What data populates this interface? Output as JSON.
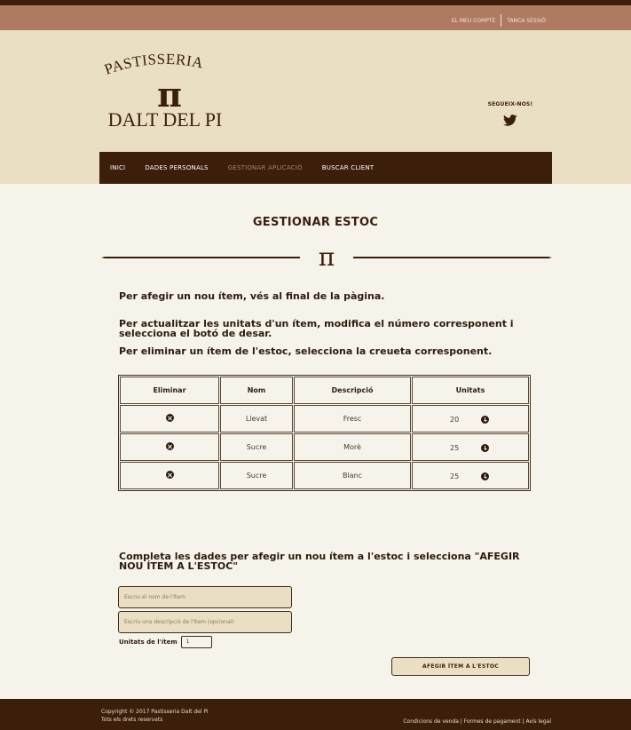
{
  "topbar": {
    "account": "EL MEU COMPTE",
    "logout": "TANCA SESSIÓ"
  },
  "logo": {
    "line1": "PASTISSERIA",
    "symbol": "π",
    "line2": "DALT DEL PI"
  },
  "social": {
    "label": "SEGUEIX-NOS!",
    "icon": "twitter-icon"
  },
  "nav": [
    {
      "label": "INICI",
      "active": false
    },
    {
      "label": "DADES PERSONALS",
      "active": false
    },
    {
      "label": "GESTIONAR APLICACIÓ",
      "active": true
    },
    {
      "label": "BUSCAR CLIENT",
      "active": false
    }
  ],
  "page": {
    "title": "GESTIONAR ESTOC",
    "divider_symbol": "π"
  },
  "instructions": {
    "line1": "Per afegir un nou ítem, vés al final de la pàgina.",
    "line2": "Per actualitzar les unitats d'un ítem, modifica el número corresponent i selecciona el botó de desar.",
    "line3": "Per eliminar un ítem de l'estoc, selecciona la creueta corresponent."
  },
  "table": {
    "headers": [
      "Eliminar",
      "Nom",
      "Descripció",
      "Unitats"
    ],
    "rows": [
      {
        "name": "Llevat",
        "description": "Fresc",
        "units": "20"
      },
      {
        "name": "Sucre",
        "description": "Morè",
        "units": "25"
      },
      {
        "name": "Sucre",
        "description": "Blanc",
        "units": "25"
      }
    ]
  },
  "form": {
    "title": "Completa les dades per afegir un nou ítem a l'estoc i selecciona \"AFEGIR NOU ÍTEM A L'ESTOC\"",
    "name_placeholder": "Escriu el nom de l'ítem",
    "desc_placeholder": "Escriu una descripció de l'ítem (opcional)",
    "units_label": "Unitats de l'ítem",
    "units_value": "1",
    "submit_label": "AFEGIR ÍTEM A L'ESTOC"
  },
  "footer": {
    "copyright": "Copyright © 2017 Pastisseria Dalt del Pi",
    "rights": "Tots els drets reservats",
    "links": "Condicions de venda | Formes de pagament | Avís legal"
  },
  "colors": {
    "dark": "#3c1f0b",
    "topbar": "#b07a62",
    "header": "#eadfc2",
    "page": "#f6f4ea",
    "nav_active": "#a38272"
  }
}
